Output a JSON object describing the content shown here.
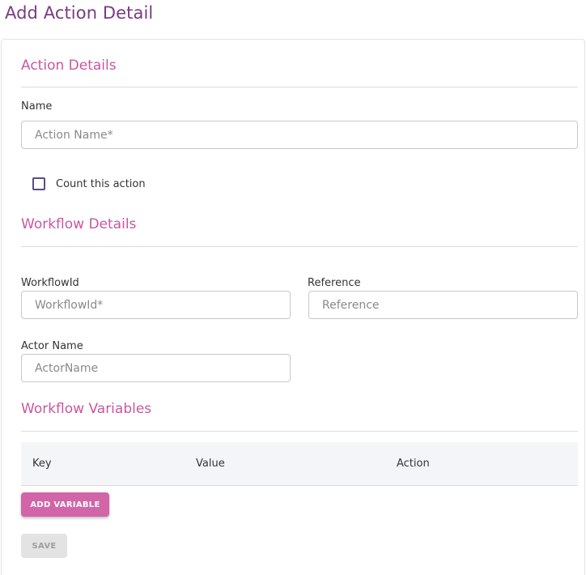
{
  "page": {
    "title": "Add Action Detail"
  },
  "action_details": {
    "title": "Action Details",
    "name_label": "Name",
    "name_placeholder": "Action Name*",
    "count_label": "Count this action",
    "count_checked": false
  },
  "workflow_details": {
    "title": "Workflow Details",
    "workflow_id_label": "WorkflowId",
    "workflow_id_placeholder": "WorkflowId*",
    "reference_label": "Reference",
    "reference_placeholder": "Reference",
    "actor_name_label": "Actor Name",
    "actor_name_placeholder": "ActorName"
  },
  "workflow_variables": {
    "title": "Workflow Variables",
    "columns": [
      "Key",
      "Value",
      "Action"
    ],
    "add_button": "ADD VARIABLE"
  },
  "actions": {
    "save_button": "SAVE"
  },
  "colors": {
    "title": "#7a3b82",
    "section": "#c9579f",
    "primary_button": "#d265a8",
    "checkbox_border": "#5a4d8a"
  }
}
